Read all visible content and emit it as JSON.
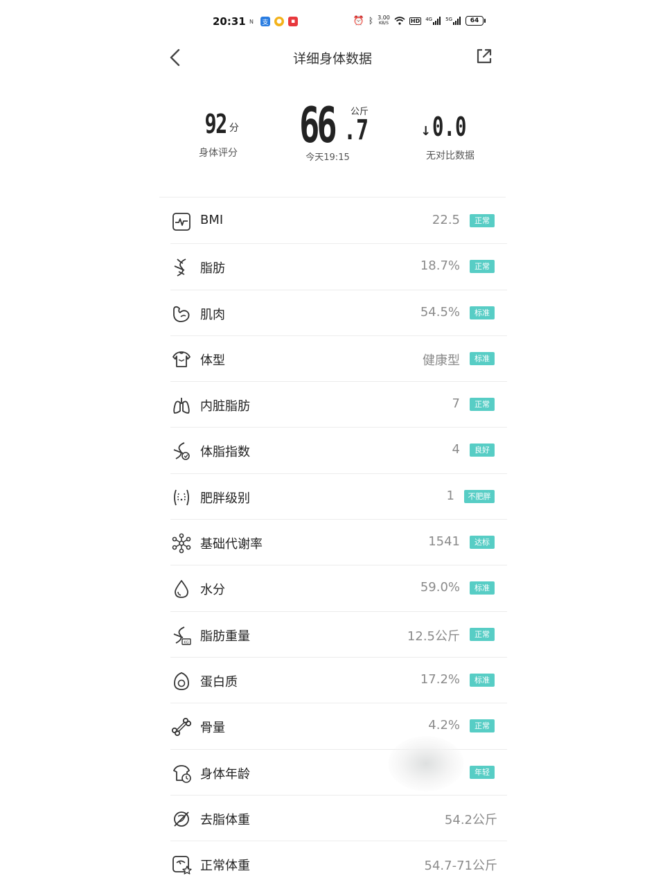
{
  "status_bar": {
    "time": "20:31",
    "net_speed_top": "3.00",
    "net_speed_bottom": "KB/S",
    "hd": "HD",
    "sig1": "4G",
    "sig2": "5G",
    "battery": "64"
  },
  "header": {
    "title": "详细身体数据"
  },
  "summary": {
    "score": {
      "value": "92",
      "unit": "分",
      "label": "身体评分"
    },
    "weight": {
      "integer": "66",
      "decimal": ".7",
      "unit": "公斤",
      "time": "今天19:15"
    },
    "delta": {
      "arrow": "↓",
      "value": "0.0",
      "label": "无对比数据"
    }
  },
  "metrics": [
    {
      "name": "BMI",
      "value": "22.5",
      "status": "正常",
      "icon": "pulse-monitor-icon"
    },
    {
      "name": "脂肪",
      "value": "18.7%",
      "status": "正常",
      "icon": "dna-icon"
    },
    {
      "name": "肌肉",
      "value": "54.5%",
      "status": "标准",
      "icon": "bicep-icon"
    },
    {
      "name": "体型",
      "value": "健康型",
      "status": "标准",
      "icon": "body-shape-icon"
    },
    {
      "name": "内脏脂肪",
      "value": "7",
      "status": "正常",
      "icon": "lungs-icon"
    },
    {
      "name": "体脂指数",
      "value": "4",
      "status": "良好",
      "icon": "fat-index-icon"
    },
    {
      "name": "肥胖级别",
      "value": "1",
      "status": "不肥胖",
      "icon": "obesity-level-icon"
    },
    {
      "name": "基础代谢率",
      "value": "1541",
      "status": "达标",
      "icon": "molecule-icon"
    },
    {
      "name": "水分",
      "value": "59.0%",
      "status": "标准",
      "icon": "water-drop-icon"
    },
    {
      "name": "脂肪重量",
      "value": "12.5公斤",
      "status": "正常",
      "icon": "fat-weight-icon"
    },
    {
      "name": "蛋白质",
      "value": "17.2%",
      "status": "标准",
      "icon": "egg-icon"
    },
    {
      "name": "骨量",
      "value": "4.2%",
      "status": "正常",
      "icon": "bone-icon"
    },
    {
      "name": "身体年龄",
      "value": "",
      "status": "年轻",
      "icon": "body-age-icon"
    },
    {
      "name": "去脂体重",
      "value": "54.2公斤",
      "status": "",
      "icon": "lean-mass-icon"
    },
    {
      "name": "正常体重",
      "value": "54.7-71公斤",
      "status": "",
      "icon": "normal-weight-icon"
    }
  ],
  "colors": {
    "badge": "#57cdc5",
    "value_text": "#8a8a8a",
    "divider": "#ececec"
  }
}
